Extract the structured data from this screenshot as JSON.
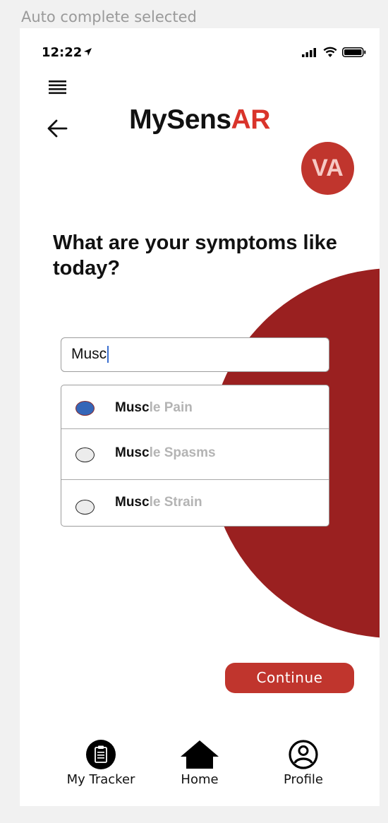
{
  "frame_label": "Auto complete selected",
  "status_bar": {
    "time": "12:22"
  },
  "app": {
    "brand_prefix": "MySens",
    "brand_accent": "AR",
    "avatar_initials": "VA"
  },
  "question": "What are your symptoms like today?",
  "search": {
    "value": "Musc"
  },
  "suggestions": [
    {
      "match": "Musc",
      "rest": "le Pain",
      "selected": true
    },
    {
      "match": "Musc",
      "rest": "le Spasms",
      "selected": false
    },
    {
      "match": "Musc",
      "rest": "le Strain",
      "selected": false
    }
  ],
  "continue_label": "Continue",
  "bottom_nav": [
    {
      "label": "My Tracker",
      "icon": "clipboard-icon"
    },
    {
      "label": "Home",
      "icon": "home-icon"
    },
    {
      "label": "Profile",
      "icon": "user-circle-icon"
    }
  ],
  "colors": {
    "accent": "#d9342b",
    "brand_red": "#c0352d",
    "circle": "#9a2020",
    "selected_radio": "#3566b8"
  }
}
